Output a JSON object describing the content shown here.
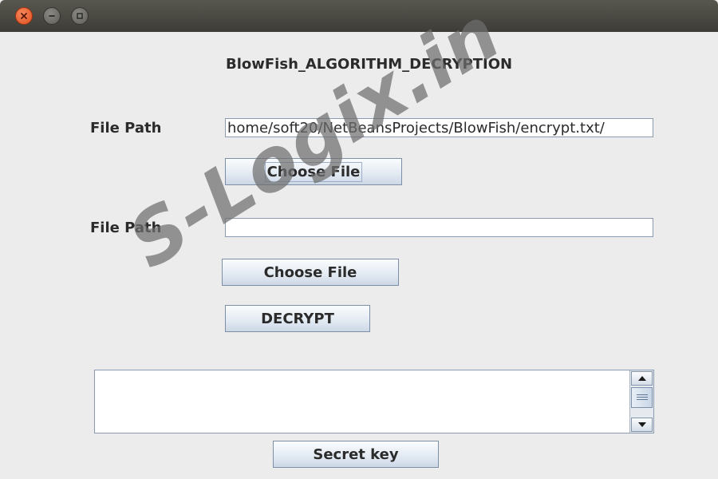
{
  "window": {
    "title_bar_buttons": [
      "close-icon",
      "minimize-icon",
      "maximize-icon"
    ]
  },
  "form": {
    "title": "BlowFish_ALGORITHM_DECRYPTION",
    "file_path_label_1": "File Path",
    "file_path_value_1": "/home/soft20/NetBeansProjects/BlowFish/encrypt.txt",
    "choose_file_label_1": "Choose File",
    "file_path_label_2": "File Path",
    "file_path_value_2": "",
    "choose_file_label_2": "Choose File",
    "decrypt_label": "DECRYPT",
    "output_text": "",
    "secret_key_label": "Secret key"
  },
  "watermark": {
    "text": "S-Logix.in"
  },
  "colors": {
    "title_bar": "#3d3c37",
    "close_button": "#e0501f",
    "background": "#ececec"
  }
}
